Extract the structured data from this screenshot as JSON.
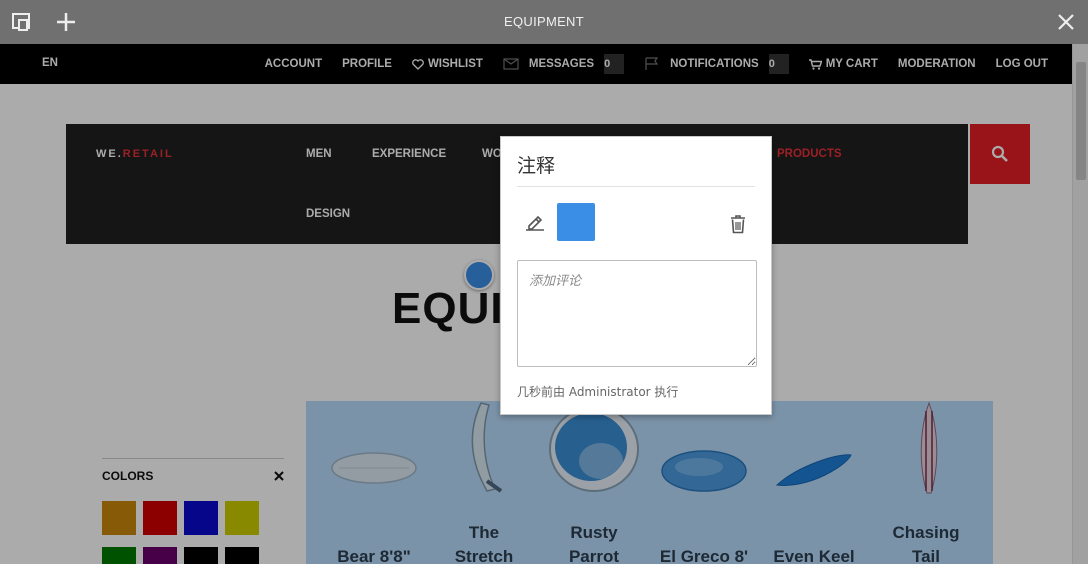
{
  "editor": {
    "title": "EQUIPMENT"
  },
  "header": {
    "lang": "EN",
    "items": [
      {
        "label": "ACCOUNT"
      },
      {
        "label": "PROFILE"
      },
      {
        "label": "WISHLIST",
        "icon": "heart-icon"
      },
      {
        "label": "MESSAGES",
        "icon": "envelope-icon",
        "count": "0"
      },
      {
        "label": "NOTIFICATIONS",
        "icon": "flag-icon",
        "count": "0"
      },
      {
        "label": "MY CART",
        "icon": "cart-icon"
      },
      {
        "label": "MODERATION"
      },
      {
        "label": "LOG OUT"
      }
    ]
  },
  "brand": {
    "left": "WE.",
    "right": "RETAIL"
  },
  "nav": {
    "men": "MEN",
    "experience": "EXPERIENCE",
    "wo": "WO",
    "products": "PRODUCTS",
    "design": "DESIGN"
  },
  "hero": {
    "title": "EQUI"
  },
  "filters": {
    "title": "COLORS",
    "swatches": [
      "#c8860a",
      "#d10000",
      "#0a0ad0",
      "#cccc00",
      "#007a00",
      "#6a006a",
      "#000000",
      "#000000"
    ]
  },
  "products": [
    {
      "line1": "",
      "line2": "Bear 8'8\""
    },
    {
      "line1": "The",
      "line2": "Stretch"
    },
    {
      "line1": "Rusty",
      "line2": "Parrot"
    },
    {
      "line1": "",
      "line2": "El Greco 8'"
    },
    {
      "line1": "",
      "line2": "Even Keel"
    },
    {
      "line1": "Chasing",
      "line2": "Tail"
    }
  ],
  "annotation": {
    "title": "注释",
    "color": "#3a8ee6",
    "placeholder": "添加评论",
    "meta": "几秒前由 Administrator 执行"
  }
}
